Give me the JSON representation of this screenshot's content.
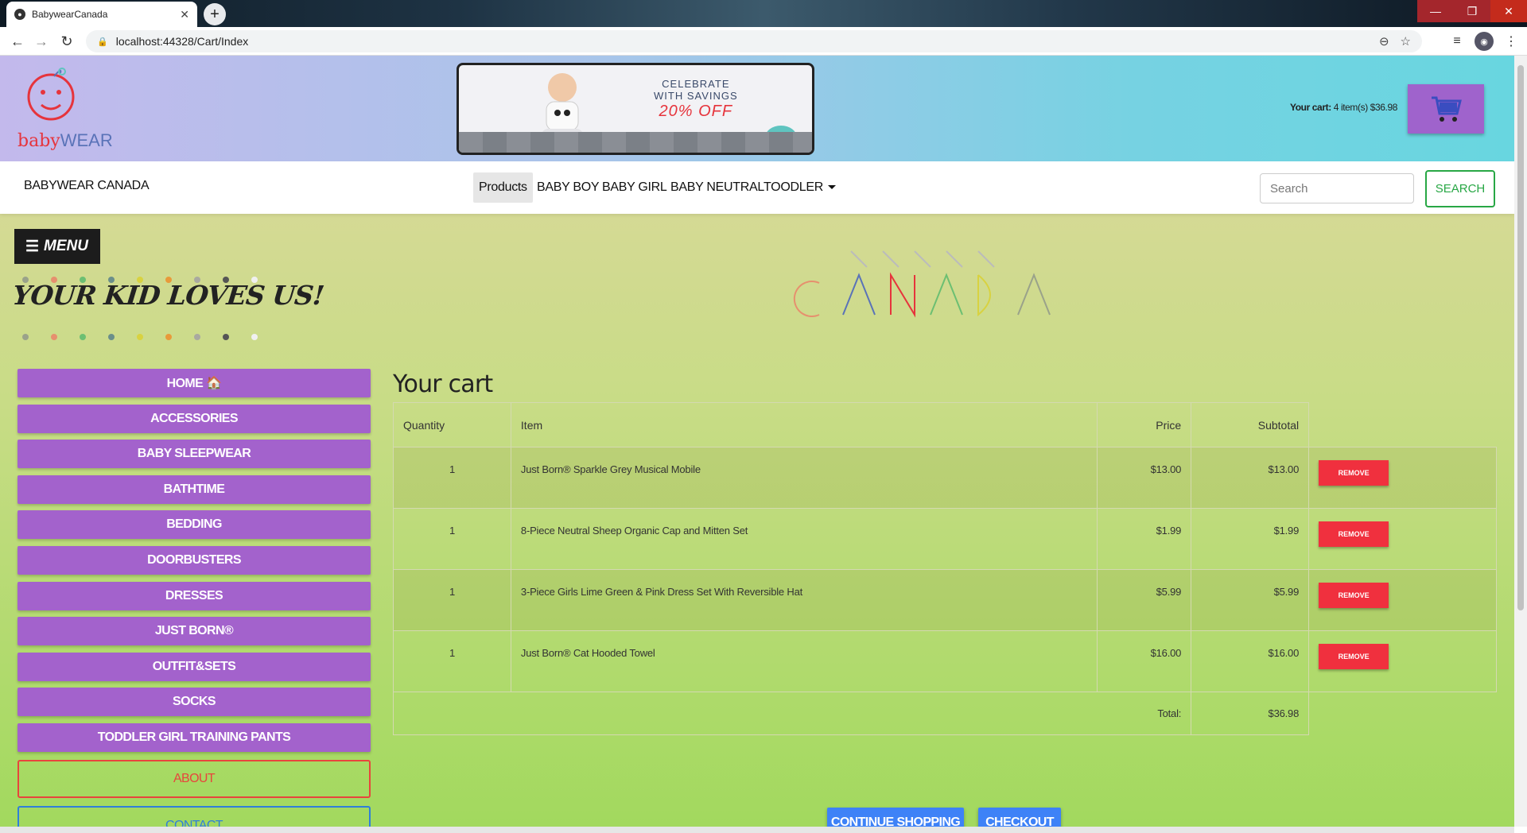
{
  "browser": {
    "tab_title": "BabywearCanada",
    "url": "localhost:44328/Cart/Index"
  },
  "banner": {
    "promo_line1": "CELEBRATE",
    "promo_line2": "WITH SAVINGS",
    "promo_pct": "20% OFF",
    "cart_label": "Your cart:",
    "cart_summary": "4 item(s) $36.98"
  },
  "navbar": {
    "brand": "BABYWEAR CANADA",
    "links": [
      "Products",
      "BABY BOY",
      "BABY GIRL",
      "BABY NEUTRAL",
      "TOODLER"
    ],
    "search_placeholder": "Search",
    "search_button": "SEARCH"
  },
  "sidebar": {
    "menu_label": "MENU",
    "tagline": "YOUR KID LOVES US!",
    "categories": [
      "HOME 🏠",
      "ACCESSORIES",
      "BABY SLEEPWEAR",
      "BATHTIME",
      "BEDDING",
      "DOORBUSTERS",
      "DRESSES",
      "JUST BORN®",
      "OUTFIT&SETS",
      "SOCKS",
      "TODDLER GIRL TRAINING PANTS"
    ],
    "about": "ABOUT",
    "contact": "CONTACT",
    "dot_colors": [
      "#9aa28a",
      "#e6906e",
      "#6cbf72",
      "#6b8f8a",
      "#d8d240",
      "#e89a3a",
      "#a9a9a0",
      "#555555",
      "#f0f0f0"
    ]
  },
  "cart": {
    "heading": "Your cart",
    "columns": {
      "quantity": "Quantity",
      "item": "Item",
      "price": "Price",
      "subtotal": "Subtotal"
    },
    "rows": [
      {
        "qty": "1",
        "item": "Just Born® Sparkle Grey Musical Mobile",
        "price": "$13.00",
        "subtotal": "$13.00"
      },
      {
        "qty": "1",
        "item": "8-Piece Neutral Sheep Organic Cap and Mitten Set",
        "price": "$1.99",
        "subtotal": "$1.99"
      },
      {
        "qty": "1",
        "item": "3-Piece Girls Lime Green & Pink Dress Set With Reversible Hat",
        "price": "$5.99",
        "subtotal": "$5.99"
      },
      {
        "qty": "1",
        "item": "Just Born® Cat Hooded Towel",
        "price": "$16.00",
        "subtotal": "$16.00"
      }
    ],
    "remove_label": "REMOVE",
    "total_label": "Total:",
    "total_value": "$36.98",
    "continue_label": "CONTINUE SHOPPING",
    "checkout_label": "CHECKOUT"
  },
  "colors": {
    "category_button": "#a362cc",
    "remove_button": "#f0303e",
    "action_button": "#3e82f7",
    "search_button": "#28a745"
  }
}
